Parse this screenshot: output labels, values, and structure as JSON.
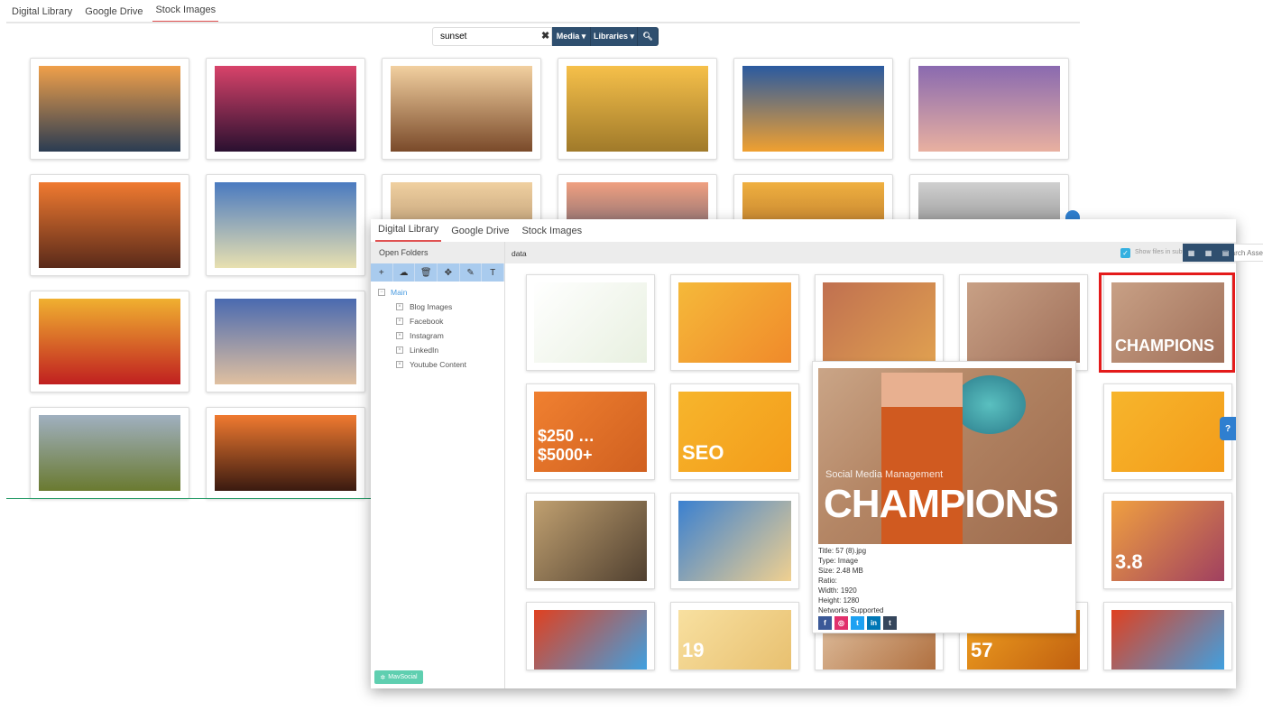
{
  "back_window": {
    "tabs": [
      {
        "label": "Digital Library"
      },
      {
        "label": "Google Drive"
      },
      {
        "label": "Stock Images",
        "active": true
      }
    ],
    "search": {
      "value": "sunset",
      "clear_icon": "times-icon"
    },
    "buttons": {
      "media": "Media ▾",
      "libraries": "Libraries ▾",
      "search_icon": "search-icon"
    },
    "thumb_colors": [
      [
        "#f0a04a",
        "#2b3c52"
      ],
      [
        "#d8436a",
        "#2a1030"
      ],
      [
        "#f2d0a0",
        "#7a4a2a"
      ],
      [
        "#f6c04a",
        "#a07a2a"
      ],
      [
        "#2a5aa0",
        "#f0a030"
      ],
      [
        "#8a6ab0",
        "#e8b0a0"
      ],
      [
        "#f07a30",
        "#5a2a1a"
      ],
      [
        "#4a7ac0",
        "#e8e0b0"
      ],
      [
        "#f0d0a0",
        "#9a7a5a"
      ],
      [
        "#f0a080",
        "#3a4a6a"
      ],
      [
        "#f0b040",
        "#9a5a20"
      ],
      [
        "#d0d0d0",
        "#6a6a6a"
      ],
      [
        "#f0b030",
        "#c02020"
      ],
      [
        "#4a6ab0",
        "#e0c0a0"
      ],
      null,
      null,
      null,
      null,
      [
        "#a0b0c0",
        "#6a7a30"
      ],
      [
        "#f07a30",
        "#3a1a10"
      ]
    ]
  },
  "front_window": {
    "tabs": [
      {
        "label": "Digital Library",
        "active": true
      },
      {
        "label": "Google Drive"
      },
      {
        "label": "Stock Images"
      }
    ],
    "left": {
      "header": "Open Folders",
      "toolbar": [
        {
          "icon": "plus-icon",
          "glyph": "+"
        },
        {
          "icon": "cloud-upload-icon",
          "glyph": "☁"
        },
        {
          "icon": "trash-icon",
          "glyph": "🗑"
        },
        {
          "icon": "move-icon",
          "glyph": "✥"
        },
        {
          "icon": "edit-icon",
          "glyph": "✎"
        },
        {
          "icon": "filter-icon",
          "glyph": "T"
        }
      ],
      "root": "Main",
      "folders": [
        "Blog Images",
        "Facebook",
        "Instagram",
        "LinkedIn",
        "Youtube Content"
      ]
    },
    "main": {
      "path": "data",
      "show_subfolders": {
        "label": "Show files in subfolder(s)",
        "checked": true
      },
      "search_placeholder": "Search Assets",
      "view_icons": [
        "grid-large-icon",
        "grid-medium-icon",
        "list-icon"
      ],
      "assets": [
        {
          "c": [
            "#ffffff",
            "#e8f0e0"
          ]
        },
        {
          "c": [
            "#f5b93a",
            "#f08a2a"
          ]
        },
        {
          "c": [
            "#c07050",
            "#e0a050"
          ]
        },
        {
          "c": [
            "#c8a085",
            "#a0705a"
          ]
        },
        {
          "c": [
            "#c8a085",
            "#a0705a"
          ],
          "text": "CHAMPIONS"
        },
        {
          "c": [
            "#f08030",
            "#d06020"
          ],
          "text": "$250 … $5000+"
        },
        {
          "c": [
            "#f7b52c",
            "#f39c1a"
          ],
          "text": "SEO"
        },
        null,
        null,
        {
          "c": [
            "#f7b52c",
            "#f39c1a"
          ]
        },
        {
          "c": [
            "#c0a070",
            "#504030"
          ]
        },
        {
          "c": [
            "#3a80d0",
            "#f0d090"
          ]
        },
        null,
        null,
        {
          "c": [
            "#f0a040",
            "#a04060"
          ],
          "text": "3.8"
        },
        {
          "c": [
            "#e04020",
            "#40a0e0"
          ]
        },
        {
          "c": [
            "#f8e0a0",
            "#e8c070"
          ],
          "text": "19"
        },
        {
          "c": [
            "#e0c0a0",
            "#b07040"
          ]
        },
        {
          "c": [
            "#f0a020",
            "#c06010"
          ],
          "text": "57"
        },
        {
          "c": [
            "#e04020",
            "#40a0e0"
          ]
        }
      ]
    },
    "preview": {
      "headline_small": "Social Media Management",
      "headline": "CHAMPIONS",
      "title": "Title: 57 (8).jpg",
      "type": "Type: Image",
      "size": "Size: 2.48 MB",
      "ratio": "Ratio:",
      "width": "Width: 1920",
      "height": "Height: 1280",
      "networks_label": "Networks Supported",
      "networks": [
        {
          "name": "facebook-icon",
          "glyph": "f",
          "color": "#3b5998"
        },
        {
          "name": "instagram-icon",
          "glyph": "◎",
          "color": "#e1306c"
        },
        {
          "name": "twitter-icon",
          "glyph": "t",
          "color": "#1da1f2"
        },
        {
          "name": "linkedin-icon",
          "glyph": "in",
          "color": "#0077b5"
        },
        {
          "name": "tumblr-icon",
          "glyph": "t",
          "color": "#35465c"
        }
      ]
    },
    "brand": "MavSocial"
  }
}
